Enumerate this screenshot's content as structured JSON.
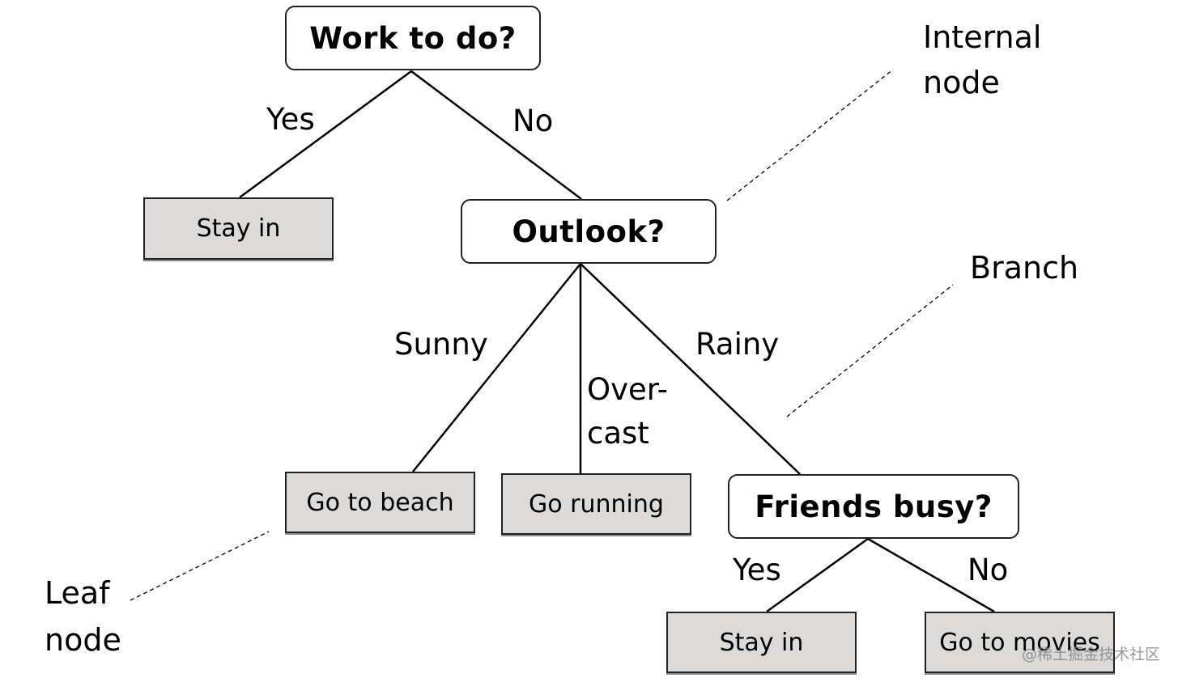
{
  "diagram": {
    "type": "decision-tree",
    "nodes": {
      "root": {
        "text": "Work to do?",
        "kind": "internal"
      },
      "stay_in_1": {
        "text": "Stay in",
        "kind": "leaf"
      },
      "outlook": {
        "text": "Outlook?",
        "kind": "internal"
      },
      "beach": {
        "text": "Go to beach",
        "kind": "leaf"
      },
      "running": {
        "text": "Go running",
        "kind": "leaf"
      },
      "friends": {
        "text": "Friends busy?",
        "kind": "internal"
      },
      "stay_in_2": {
        "text": "Stay in",
        "kind": "leaf"
      },
      "movies": {
        "text": "Go to movies",
        "kind": "leaf"
      }
    },
    "edges": [
      {
        "from": "root",
        "to": "stay_in_1",
        "label": "Yes"
      },
      {
        "from": "root",
        "to": "outlook",
        "label": "No"
      },
      {
        "from": "outlook",
        "to": "beach",
        "label": "Sunny"
      },
      {
        "from": "outlook",
        "to": "running",
        "label_line1": "Over-",
        "label_line2": "cast"
      },
      {
        "from": "outlook",
        "to": "friends",
        "label": "Rainy"
      },
      {
        "from": "friends",
        "to": "stay_in_2",
        "label": "Yes"
      },
      {
        "from": "friends",
        "to": "movies",
        "label": "No"
      }
    ],
    "annotations": {
      "internal_node": {
        "line1": "Internal",
        "line2": "node"
      },
      "branch": {
        "line1": "Branch"
      },
      "leaf_node": {
        "line1": "Leaf",
        "line2": "node"
      }
    },
    "colors": {
      "leaf_fill": "#dcdbda",
      "internal_fill": "#ffffff",
      "stroke": "#222222"
    }
  },
  "watermark": "@稀土掘金技术社区"
}
